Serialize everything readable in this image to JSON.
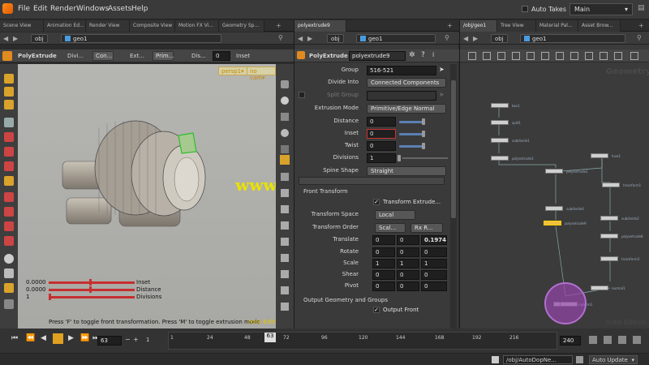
{
  "menubar": {
    "items": [
      "File",
      "Edit",
      "Render",
      "Windows",
      "Assets",
      "Help"
    ],
    "auto_takes": "Auto Takes",
    "desktop": "Main"
  },
  "left_pane": {
    "tabs": [
      "Scene View",
      "Animation Ed...",
      "Render View",
      "Composite View",
      "Motion FX Vi...",
      "Geometry Sp..."
    ],
    "path_obj": "obj",
    "path_geo": "geo1"
  },
  "mid_pane": {
    "tab": "polyextrude9",
    "path_obj": "obj",
    "path_geo": "geo1"
  },
  "right_pane": {
    "tabs": [
      "/obj/geo1",
      "Tree View",
      "Material Pal...",
      "Asset Brow..."
    ],
    "path_obj": "obj",
    "path_geo": "geo1",
    "watermark_geometry": "Geometry",
    "watermark_edition": "Indie Edition"
  },
  "viewport_toolbar": {
    "tool_name": "PolyExtrude",
    "divide_label": "Divi...",
    "divide_btn": "Con...",
    "extrude_label": "Ext...",
    "extrude_btn": "Prim...",
    "distance_label": "Dis...",
    "distance_value": "0",
    "inset_label": "Inset"
  },
  "viewport": {
    "persp_btn": "persp1▾",
    "cam_btn": "no cam▾",
    "watermark": "www.cgtsj.com",
    "status": "Press 'F' to toggle front transformation. Press 'M' to toggle extrusion mode",
    "edition": "Indie Edition",
    "hud": [
      {
        "value": "0.0000",
        "label": "Inset"
      },
      {
        "value": "0.0000",
        "label": "Distance"
      },
      {
        "value": "1",
        "label": "Divisions"
      }
    ]
  },
  "params": {
    "node_type": "PolyExtrude",
    "node_name": "polyextrude9",
    "group_label": "Group",
    "group_value": "516-521",
    "divide_into_label": "Divide Into",
    "divide_into_value": "Connected Components",
    "split_group_label": "Split Group",
    "extrusion_mode_label": "Extrusion Mode",
    "extrusion_mode_value": "Primitive/Edge Normal",
    "distance_label": "Distance",
    "distance_value": "0",
    "inset_label": "Inset",
    "inset_value": "0",
    "twist_label": "Twist",
    "twist_value": "0",
    "divisions_label": "Divisions",
    "divisions_value": "1",
    "spine_shape_label": "Spine Shape",
    "spine_shape_value": "Straight",
    "front_transform_header": "Front Transform",
    "transform_extruded_label": "Transform Extrude...",
    "transform_space_label": "Transform Space",
    "transform_space_value": "Local",
    "transform_order_label": "Transform Order",
    "transform_order_a": "Scal...",
    "transform_order_b": "Rx R...",
    "translate_label": "Translate",
    "translate_values": [
      "0",
      "0",
      "0.1974"
    ],
    "rotate_label": "Rotate",
    "rotate_values": [
      "0",
      "0",
      "0"
    ],
    "scale_label": "Scale",
    "scale_values": [
      "1",
      "1",
      "1"
    ],
    "shear_label": "Shear",
    "shear_values": [
      "0",
      "0",
      "0"
    ],
    "pivot_label": "Pivot",
    "pivot_values": [
      "0",
      "0",
      "0"
    ],
    "output_header": "Output Geometry and Groups",
    "output_front_label": "Output Front"
  },
  "network": {
    "nodes": [
      {
        "name": "box1"
      },
      {
        "name": "split1"
      },
      {
        "name": "subdivide1"
      },
      {
        "name": "polyextrude3"
      },
      {
        "name": "polyextrude2"
      },
      {
        "name": "fuse1"
      },
      {
        "name": "transform1"
      },
      {
        "name": "subdivide4"
      },
      {
        "name": "polyextrude9"
      },
      {
        "name": "subdivide2"
      },
      {
        "name": "polyextrude8"
      },
      {
        "name": "transform3"
      },
      {
        "name": "normal1"
      },
      {
        "name": "merge1"
      },
      {
        "name": "xform1"
      }
    ]
  },
  "timeline": {
    "ticks": [
      "1",
      "24",
      "48",
      "72",
      "96",
      "120",
      "144",
      "168",
      "192",
      "216"
    ],
    "current_frame": "63",
    "field_frame": "63",
    "start": "1",
    "end": "240",
    "step": "1"
  },
  "statusbar": {
    "path": "/obj/AutoDopNe...",
    "auto_update": "Auto Update"
  }
}
